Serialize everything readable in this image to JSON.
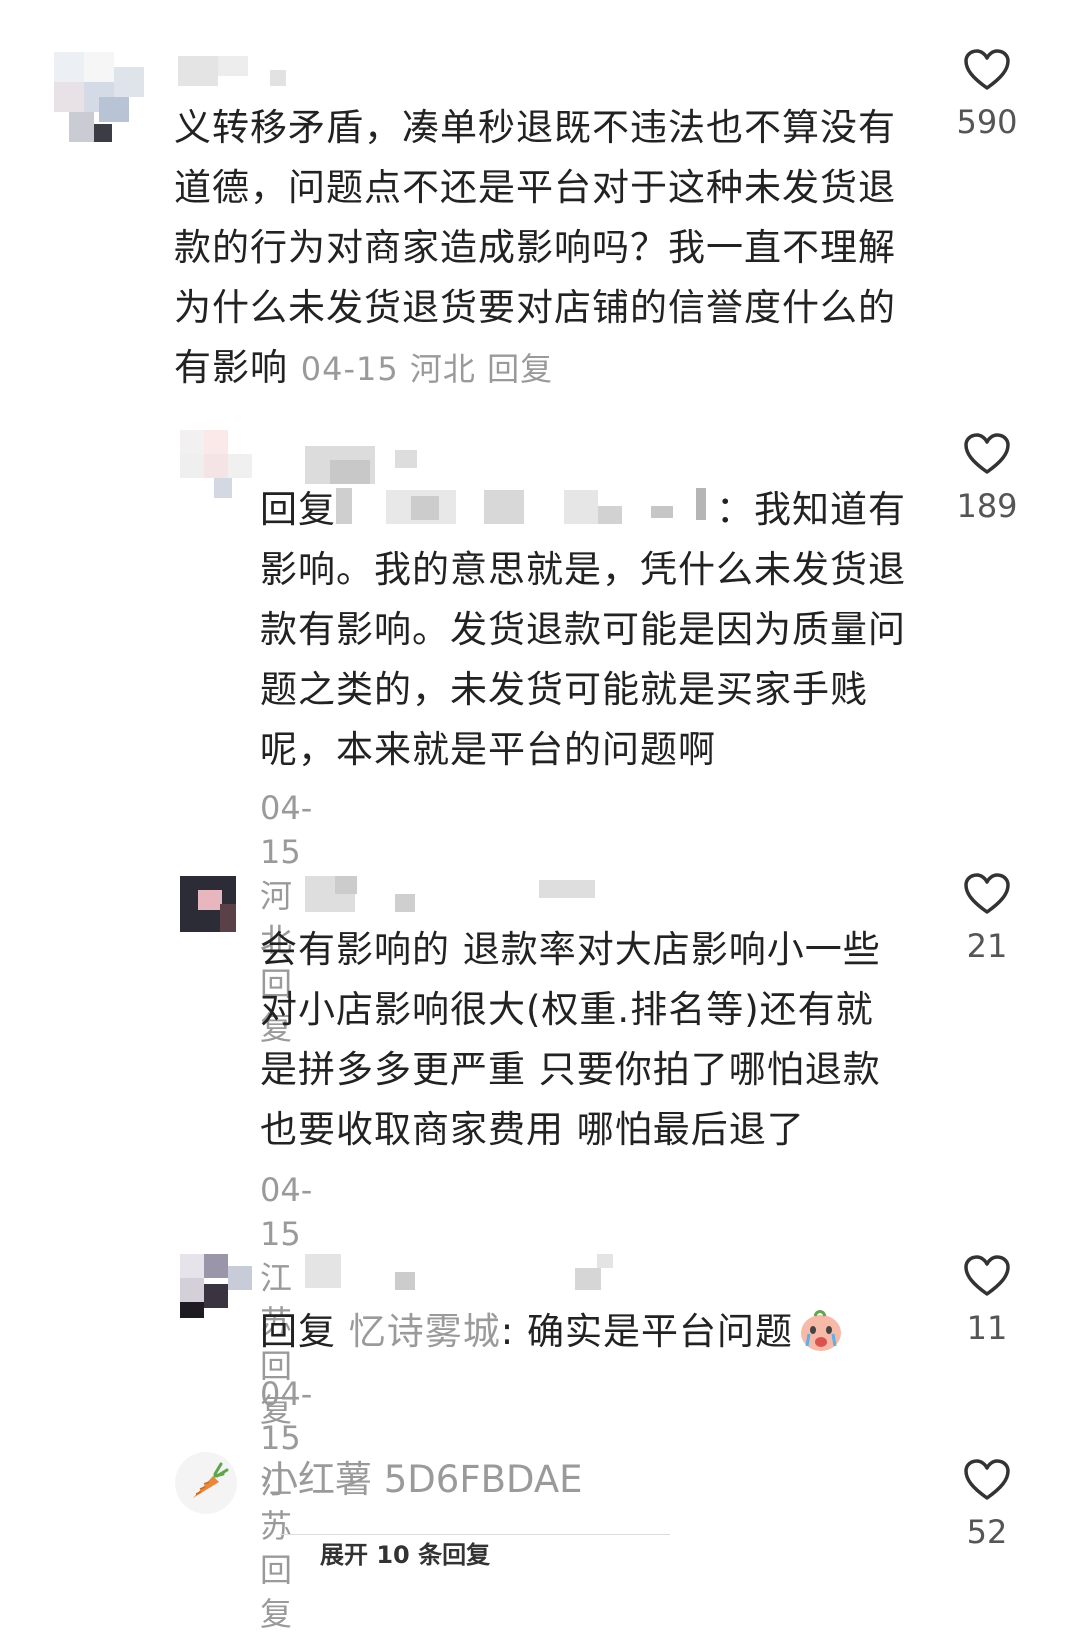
{
  "comments": [
    {
      "text": "义转移矛盾，凑单秒退既不违法也不算没有道德，问题点不还是平台对于这种未发货退款的行为对商家造成影响吗？我一直不理解为什么未发货退货要对店铺的信誉度什么的有影响",
      "date": "04-15",
      "location": "河北",
      "reply_label": "回复",
      "likes": "590"
    },
    {
      "reply_prefix": "回复",
      "text_after_mention": "：我知道有影响。我的意思就是，凭什么未发货退款有影响。发货退款可能是因为质量问题之类的，未发货可能就是买家手贱呢，本来就是平台的问题啊",
      "date": "04-15",
      "location": "河北",
      "reply_label": "回复",
      "likes": "189"
    },
    {
      "text": "会有影响的 退款率对大店影响小一些对小店影响很大(权重.排名等)还有就是拼多多更严重 只要你拍了哪怕退款也要收取商家费用 哪怕最后退了",
      "date": "04-15",
      "location": "江苏",
      "reply_label": "回复",
      "likes": "21"
    },
    {
      "reply_prefix": "回复",
      "reply_target": "忆诗雾城",
      "text_after_mention": ": 确实是平台问题",
      "emoji": "crying-face-sticker",
      "date": "04-15",
      "location": "江苏",
      "reply_label": "回复",
      "likes": "11"
    }
  ],
  "reply_input": {
    "icon": "carrot-icon",
    "user_label": "小红薯 5D6FBDAE",
    "likes": "52"
  },
  "expand_replies_label": "展开 10 条回复",
  "icons": {
    "like": "heart-outline-icon"
  },
  "colors": {
    "text": "#222222",
    "meta": "#9a9a9a",
    "accent_carrot": "#e8883a"
  }
}
